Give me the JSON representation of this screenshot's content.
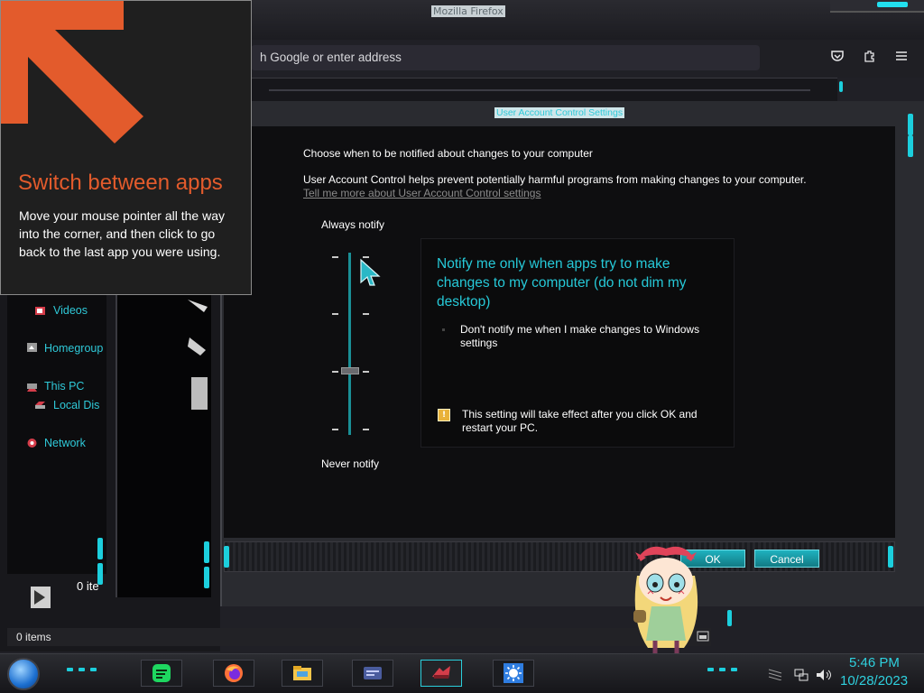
{
  "firefox": {
    "window_title": "Mozilla Firefox",
    "address_placeholder": "h Google or enter address"
  },
  "tooltip": {
    "title": "Switch between apps",
    "body": "Move your mouse pointer all the way into the corner, and then click to go back to the last app you were using."
  },
  "uac": {
    "window_title": "User Account Control Settings",
    "heading": "Choose when to be notified about changes to your computer",
    "description": "User Account Control helps prevent potentially harmful programs from making changes to your computer.",
    "link": "Tell me more about User Account Control settings",
    "slider_top_label": "Always notify",
    "slider_bottom_label": "Never notify",
    "slider_level": "3 of 4",
    "panel_heading": "Notify me only when apps try to make changes to my computer (do not dim my desktop)",
    "panel_bullet": "Don't notify me when I make changes to Windows settings",
    "panel_note": "This setting will take effect after you click OK and restart your PC.",
    "ok_label": "OK",
    "cancel_label": "Cancel"
  },
  "explorer": {
    "nav": [
      {
        "label": "Videos",
        "icon": "video-icon"
      },
      {
        "label": "Homegroup",
        "icon": "homegroup-icon"
      },
      {
        "label": "This PC",
        "icon": "computer-icon"
      },
      {
        "label": "Local Dis",
        "icon": "drive-icon"
      },
      {
        "label": "Network",
        "icon": "network-icon"
      }
    ],
    "items_count_status": "0 items",
    "items_count_partial": "0 ite"
  },
  "taskbar": {
    "time": "5:46 PM",
    "date": "10/28/2023",
    "apps": [
      "spotify-icon",
      "firefox-icon",
      "file-explorer-icon",
      "control-panel-icon",
      "uac-settings-icon",
      "brightness-icon"
    ]
  },
  "colors": {
    "accent": "#26c9d8",
    "tooltip_title": "#e35b2c",
    "panel_bg": "#0e0e10"
  }
}
